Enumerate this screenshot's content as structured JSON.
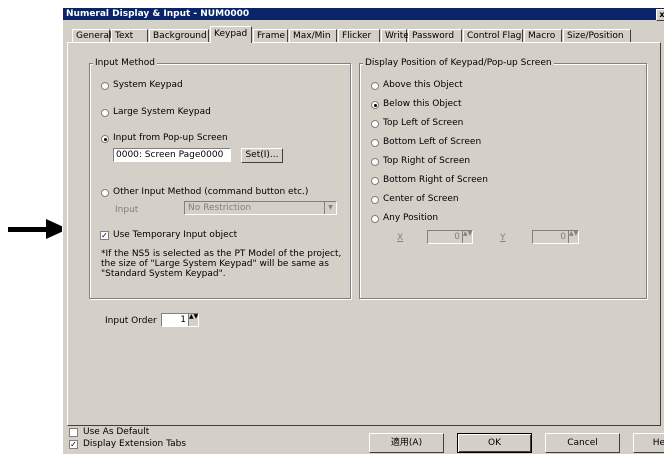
{
  "window": {
    "title": "Numeral Display & Input - NUM0000",
    "close_glyph": "x"
  },
  "tabs": [
    "General",
    "Text",
    "Background",
    "Keypad",
    "Frame",
    "Max/Min",
    "Flicker",
    "Write",
    "Password",
    "Control Flag",
    "Macro",
    "Size/Position"
  ],
  "active_tab": "Keypad",
  "input_method": {
    "legend": "Input Method",
    "system_keypad": "System Keypad",
    "large_system_keypad": "Large System Keypad",
    "popup_screen": "Input from Pop-up Screen",
    "popup_screen_value": "0000: Screen Page0000",
    "set_button": "Set(I)...",
    "other_method": "Other Input Method (command button etc.)",
    "input_label": "Input",
    "input_select_value": "No Restriction",
    "use_temporary": "Use Temporary Input object",
    "use_temporary_checked": true,
    "note": "*If the NS5 is selected as the PT Model of the project, the size of \"Large System Keypad\" will be same as \"Standard System Keypad\".",
    "selected": "popup_screen"
  },
  "display_position": {
    "legend": "Display Position of Keypad/Pop-up Screen",
    "options": [
      "Above this Object",
      "Below this Object",
      "Top Left of Screen",
      "Bottom Left of Screen",
      "Top Right of Screen",
      "Bottom Right of Screen",
      "Center of Screen",
      "Any Position"
    ],
    "selected_index": 1,
    "x_label": "X",
    "x_value": "0",
    "y_label": "Y",
    "y_value": "0"
  },
  "input_order": {
    "label": "Input Order",
    "value": "1"
  },
  "footer": {
    "use_as_default": "Use As Default",
    "use_as_default_checked": false,
    "display_extension_tabs": "Display Extension Tabs",
    "display_extension_tabs_checked": true,
    "apply_button": "適用(A)",
    "ok_button": "OK",
    "cancel_button": "Cancel",
    "help_button": "Help"
  },
  "glyphs": {
    "check": "✓",
    "dropdown": "▼",
    "spin": "▲▼"
  }
}
